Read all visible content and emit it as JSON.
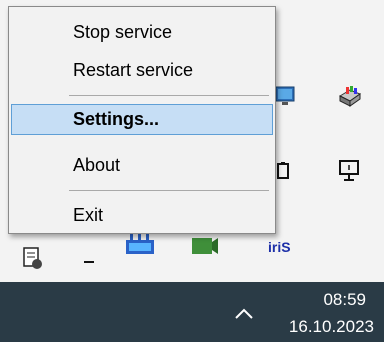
{
  "context_menu": {
    "items": [
      {
        "label": "Stop service"
      },
      {
        "label": "Restart service"
      },
      {
        "label": "Settings..."
      },
      {
        "label": "About"
      },
      {
        "label": "Exit"
      }
    ]
  },
  "taskbar": {
    "time": "08:59",
    "date": "16.10.2023"
  },
  "icons": [
    "display-icon",
    "printer-icon",
    "battery-icon",
    "monitor-icon",
    "network-card-icon",
    "tray-app-icon",
    "brand-icon",
    "window-icon",
    "minus-icon",
    "chevron-up-icon"
  ],
  "colors": {
    "menu_highlight": "#c6def5",
    "menu_highlight_border": "#5f9fd6",
    "taskbar": "#2a3b46"
  }
}
